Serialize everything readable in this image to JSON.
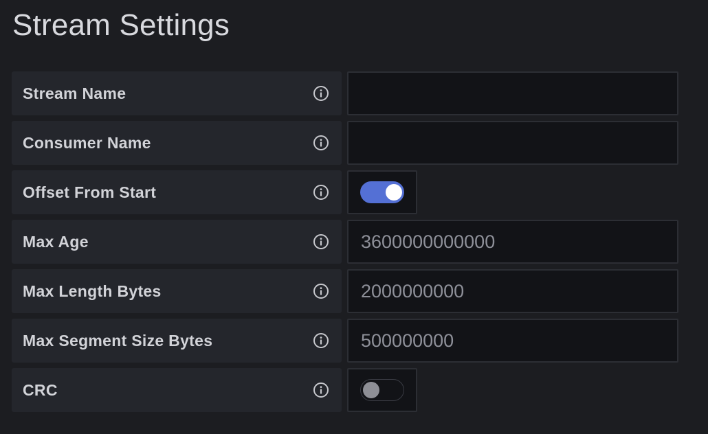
{
  "header": {
    "title": "Stream Settings"
  },
  "fields": [
    {
      "label": "Stream Name",
      "type": "text",
      "value": "",
      "placeholder": "",
      "icon": "info-circle-icon"
    },
    {
      "label": "Consumer Name",
      "type": "text",
      "value": "",
      "placeholder": "",
      "icon": "info-circle-icon"
    },
    {
      "label": "Offset From Start",
      "type": "switch",
      "checked": true,
      "icon": "info-circle-icon"
    },
    {
      "label": "Max Age",
      "type": "text",
      "value": "",
      "placeholder": "3600000000000",
      "icon": "info-circle-icon"
    },
    {
      "label": "Max Length Bytes",
      "type": "text",
      "value": "",
      "placeholder": "2000000000",
      "icon": "info-circle-icon"
    },
    {
      "label": "Max Segment Size Bytes",
      "type": "text",
      "value": "",
      "placeholder": "500000000",
      "icon": "info-circle-icon"
    },
    {
      "label": "CRC",
      "type": "switch",
      "checked": false,
      "icon": "info-circle-icon"
    }
  ],
  "colors": {
    "background": "#1c1d21",
    "label_background": "#24262c",
    "input_background": "#121317",
    "switch_on": "#5470d5",
    "switch_off_knob": "#8e8f96"
  }
}
